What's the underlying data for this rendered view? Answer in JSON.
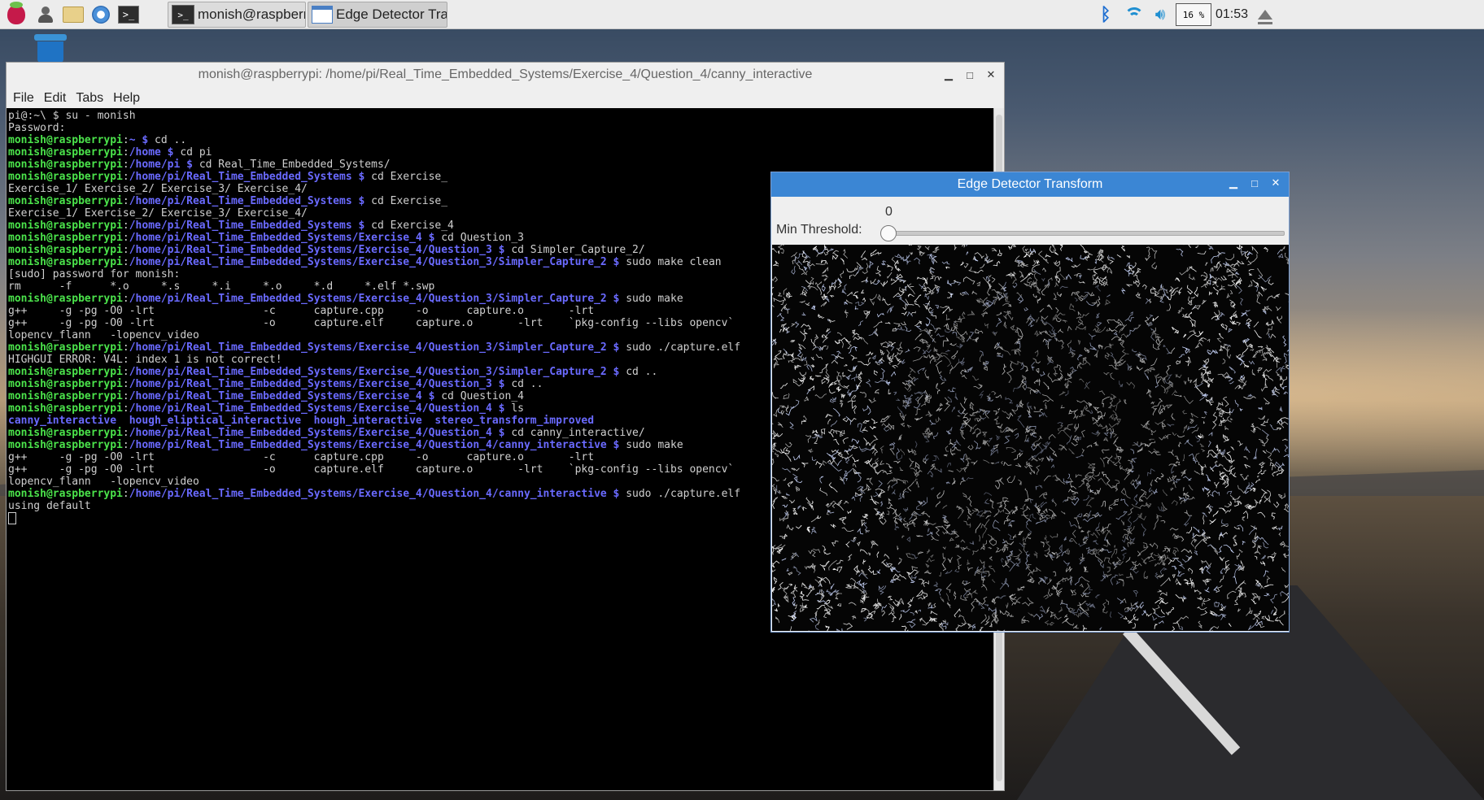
{
  "taskbar": {
    "launchers": [
      "raspberry-menu",
      "user-icon",
      "file-manager",
      "web-browser",
      "terminal"
    ],
    "tasks": [
      {
        "label": "monish@raspberrypi:...",
        "icon": "terminal-icon"
      },
      {
        "label": "Edge Detector Transf...",
        "icon": "window-icon"
      }
    ],
    "cpu": "16 %",
    "clock": "01:53",
    "colors": {
      "bluetooth": "#1f6fd1",
      "tray_blue": "#1f8fd1"
    }
  },
  "terminal": {
    "title": "monish@raspberrypi: /home/pi/Real_Time_Embedded_Systems/Exercise_4/Question_4/canny_interactive",
    "menu": [
      "File",
      "Edit",
      "Tabs",
      "Help"
    ],
    "colors": {
      "user": "#4be34b",
      "path": "#6a6aff",
      "text": "#cfcfcf",
      "background": "#000000"
    },
    "lines": [
      {
        "plain": "pi@:~\\ $ su - monish"
      },
      {
        "plain": "Password:"
      },
      {
        "user": "monish@raspberrypi",
        "path": "~",
        "cmd": "cd .."
      },
      {
        "user": "monish@raspberrypi",
        "path": "/home",
        "cmd": "cd pi"
      },
      {
        "user": "monish@raspberrypi",
        "path": "/home/pi",
        "cmd": "cd Real_Time_Embedded_Systems/"
      },
      {
        "user": "monish@raspberrypi",
        "path": "/home/pi/Real_Time_Embedded_Systems",
        "cmd": "cd Exercise_"
      },
      {
        "plain": "Exercise_1/ Exercise_2/ Exercise_3/ Exercise_4/"
      },
      {
        "user": "monish@raspberrypi",
        "path": "/home/pi/Real_Time_Embedded_Systems",
        "cmd": "cd Exercise_"
      },
      {
        "plain": "Exercise_1/ Exercise_2/ Exercise_3/ Exercise_4/"
      },
      {
        "user": "monish@raspberrypi",
        "path": "/home/pi/Real_Time_Embedded_Systems",
        "cmd": "cd Exercise_4"
      },
      {
        "user": "monish@raspberrypi",
        "path": "/home/pi/Real_Time_Embedded_Systems/Exercise_4",
        "cmd": "cd Question_3"
      },
      {
        "user": "monish@raspberrypi",
        "path": "/home/pi/Real_Time_Embedded_Systems/Exercise_4/Question_3",
        "cmd": "cd Simpler_Capture_2/"
      },
      {
        "user": "monish@raspberrypi",
        "path": "/home/pi/Real_Time_Embedded_Systems/Exercise_4/Question_3/Simpler_Capture_2",
        "cmd": "sudo make clean"
      },
      {
        "plain": "[sudo] password for monish:"
      },
      {
        "plain": "rm      -f      *.o     *.s     *.i     *.o     *.d     *.elf *.swp"
      },
      {
        "user": "monish@raspberrypi",
        "path": "/home/pi/Real_Time_Embedded_Systems/Exercise_4/Question_3/Simpler_Capture_2",
        "cmd": "sudo make"
      },
      {
        "plain": "g++     -g -pg -O0 -lrt                 -c      capture.cpp     -o      capture.o       -lrt"
      },
      {
        "plain": "g++     -g -pg -O0 -lrt                 -o      capture.elf     capture.o       -lrt    `pkg-config --libs opencv`"
      },
      {
        "plain": "lopencv_flann   -lopencv_video"
      },
      {
        "user": "monish@raspberrypi",
        "path": "/home/pi/Real_Time_Embedded_Systems/Exercise_4/Question_3/Simpler_Capture_2",
        "cmd": "sudo ./capture.elf"
      },
      {
        "plain": "HIGHGUI ERROR: V4L: index 1 is not correct!"
      },
      {
        "user": "monish@raspberrypi",
        "path": "/home/pi/Real_Time_Embedded_Systems/Exercise_4/Question_3/Simpler_Capture_2",
        "cmd": "cd .."
      },
      {
        "user": "monish@raspberrypi",
        "path": "/home/pi/Real_Time_Embedded_Systems/Exercise_4/Question_3",
        "cmd": "cd .."
      },
      {
        "user": "monish@raspberrypi",
        "path": "/home/pi/Real_Time_Embedded_Systems/Exercise_4",
        "cmd": "cd Question_4"
      },
      {
        "user": "monish@raspberrypi",
        "path": "/home/pi/Real_Time_Embedded_Systems/Exercise_4/Question_4",
        "cmd": "ls"
      },
      {
        "ls": "canny_interactive  hough_eliptical_interactive  hough_interactive  stereo_transform_improved"
      },
      {
        "user": "monish@raspberrypi",
        "path": "/home/pi/Real_Time_Embedded_Systems/Exercise_4/Question_4",
        "cmd": "cd canny_interactive/"
      },
      {
        "user": "monish@raspberrypi",
        "path": "/home/pi/Real_Time_Embedded_Systems/Exercise_4/Question_4/canny_interactive",
        "cmd": "sudo make"
      },
      {
        "plain": "g++     -g -pg -O0 -lrt                 -c      capture.cpp     -o      capture.o       -lrt"
      },
      {
        "plain": "g++     -g -pg -O0 -lrt                 -o      capture.elf     capture.o       -lrt    `pkg-config --libs opencv`"
      },
      {
        "plain": "lopencv_flann   -lopencv_video"
      },
      {
        "user": "monish@raspberrypi",
        "path": "/home/pi/Real_Time_Embedded_Systems/Exercise_4/Question_4/canny_interactive",
        "cmd": "sudo ./capture.elf"
      },
      {
        "plain": "using default"
      }
    ]
  },
  "edge_window": {
    "title": "Edge Detector Transform",
    "slider_label": "Min Threshold:",
    "slider_value": "0",
    "slider_fraction": 0.0
  }
}
